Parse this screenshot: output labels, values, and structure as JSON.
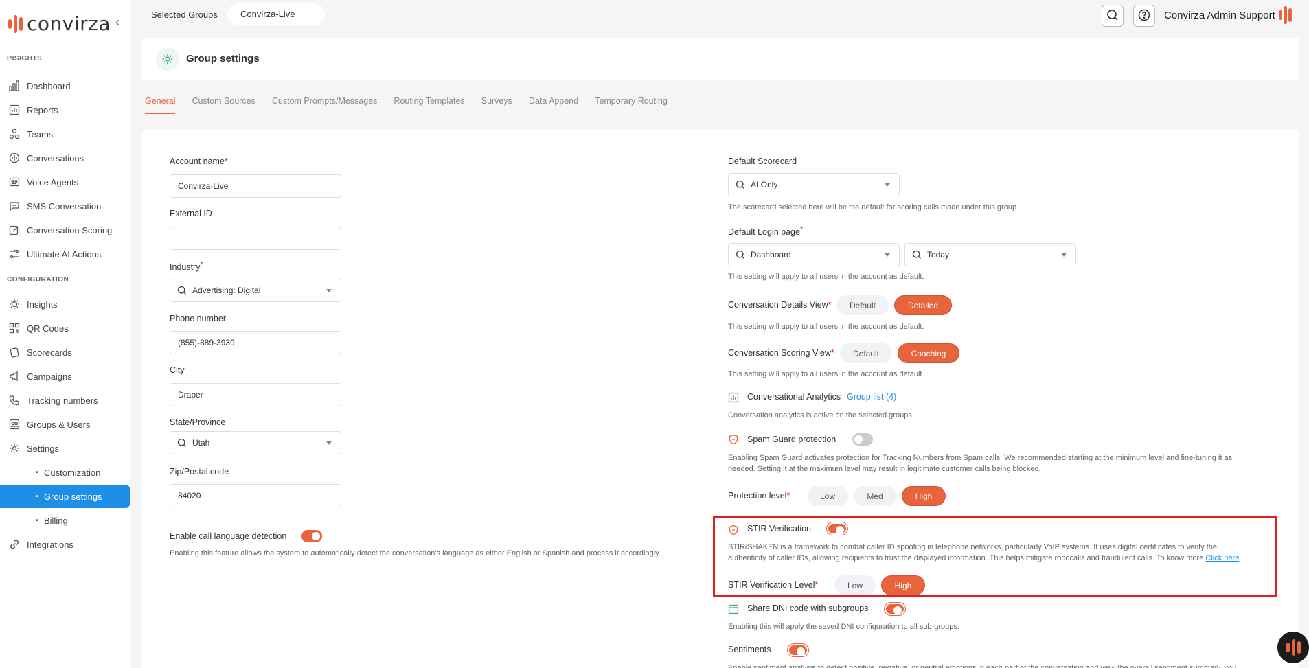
{
  "brand": {
    "name": "convirza",
    "accent": "#e8643c",
    "active_nav": "#1e8fe6"
  },
  "sidebar": {
    "sections": [
      {
        "label": "INSIGHTS"
      },
      {
        "label": "CONFIGURATION"
      }
    ],
    "items": [
      {
        "label": "Dashboard",
        "icon": "bar-chart-icon"
      },
      {
        "label": "Reports",
        "icon": "report-icon"
      },
      {
        "label": "Teams",
        "icon": "teams-icon"
      },
      {
        "label": "Conversations",
        "icon": "conversations-icon"
      },
      {
        "label": "Voice Agents",
        "icon": "voice-agent-icon"
      },
      {
        "label": "SMS Conversation",
        "icon": "sms-icon"
      },
      {
        "label": "Conversation Scoring",
        "icon": "scoring-icon"
      },
      {
        "label": "Ultimate AI Actions",
        "icon": "ai-actions-icon"
      },
      {
        "label": "Insights",
        "icon": "lightbulb-icon"
      },
      {
        "label": "QR Codes",
        "icon": "qr-code-icon"
      },
      {
        "label": "Scorecards",
        "icon": "scorecard-icon"
      },
      {
        "label": "Campaigns",
        "icon": "megaphone-icon"
      },
      {
        "label": "Tracking numbers",
        "icon": "phone-icon"
      },
      {
        "label": "Groups & Users",
        "icon": "users-icon"
      },
      {
        "label": "Settings",
        "icon": "gear-icon"
      },
      {
        "label": "Customization"
      },
      {
        "label": "Group settings"
      },
      {
        "label": "Billing"
      },
      {
        "label": "Integrations",
        "icon": "link-icon"
      }
    ]
  },
  "topbar": {
    "selected_groups_label": "Selected Groups",
    "group": "Convirza-Live",
    "user": "Convirza Admin Support"
  },
  "header": {
    "title": "Group settings"
  },
  "tabs": [
    "General",
    "Custom Sources",
    "Custom Prompts/Messages",
    "Routing Templates",
    "Surveys",
    "Data Append",
    "Temporary Routing"
  ],
  "left": {
    "account_name": {
      "label": "Account name",
      "value": "Convirza-Live"
    },
    "external_id": {
      "label": "External ID",
      "value": ""
    },
    "industry": {
      "label": "Industry",
      "value": "Advertising: Digital"
    },
    "phone": {
      "label": "Phone number",
      "value": "(855)-889-3939"
    },
    "city": {
      "label": "City",
      "value": "Draper"
    },
    "state": {
      "label": "State/Province",
      "value": "Utah"
    },
    "zip": {
      "label": "Zip/Postal code",
      "value": "84020"
    },
    "lang_detect": {
      "label": "Enable call language detection",
      "help": "Enabling this feature allows the system to automatically detect the conversation's language as either English or Spanish and process it accordingly."
    }
  },
  "right": {
    "scorecard": {
      "label": "Default Scorecard",
      "value": "AI Only",
      "help": "The scorecard selected here will be the default for scoring calls made under this group."
    },
    "login_page": {
      "label": "Default Login page",
      "value": "Dashboard",
      "value2": "Today",
      "help": "This setting will apply to all users in the account as default."
    },
    "details_view": {
      "label": "Conversation Details View",
      "options": [
        "Default",
        "Detailed"
      ],
      "help": "This setting will apply to all users in the account as default."
    },
    "scoring_view": {
      "label": "Conversation Scoring View",
      "options": [
        "Default",
        "Coaching"
      ],
      "help": "This setting will apply to all users in the account as default."
    },
    "analytics": {
      "label": "Conversational Analytics",
      "link": "Group list (4)",
      "help": "Conversation analytics is active on the selected groups."
    },
    "spam_guard": {
      "label": "Spam Guard protection",
      "help1": "Enabling Spam Guard activates protection for Tracking Numbers from Spam calls. We recommended starting at the minimum level and fine-tuning it as",
      "help2": "needed.  Setting it at the maximum level may result in legitimate customer calls being blocked."
    },
    "protection": {
      "label": "Protection level",
      "options": [
        "Low",
        "Med",
        "High"
      ]
    },
    "stir": {
      "label": "STIR Verification",
      "help1": "STIR/SHAKEN is a framework to combat caller ID spoofing in telephone networks, particularly VoIP systems. It uses digital certificates to verify the",
      "help2": "authenticity of caller IDs, allowing recipients to trust the displayed information. This helps mitigate robocalls and fraudulent calls. To know more",
      "link": "Click here",
      "level_label": "STIR Verification Level",
      "options": [
        "Low",
        "High"
      ]
    },
    "dni": {
      "label": "Share DNI code with subgroups",
      "help": "Enabling this will apply the saved DNI configuration to all sub-groups."
    },
    "sentiments": {
      "label": "Sentiments",
      "help": "Enable sentiment analysis to detect positive, negative, or neutral emotions in each part of the conversation and view the overall sentiment summary, you"
    }
  }
}
